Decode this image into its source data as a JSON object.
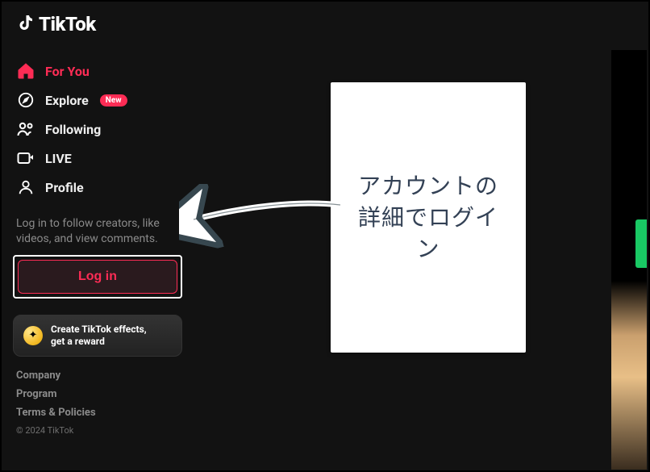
{
  "brand": {
    "name": "TikTok"
  },
  "sidebar": {
    "items": [
      {
        "label": "For You",
        "icon": "home",
        "active": true
      },
      {
        "label": "Explore",
        "icon": "compass",
        "badge": "New"
      },
      {
        "label": "Following",
        "icon": "following"
      },
      {
        "label": "LIVE",
        "icon": "live"
      },
      {
        "label": "Profile",
        "icon": "profile"
      }
    ],
    "login_hint": "Log in to follow creators, like videos, and view comments.",
    "login_button": "Log in",
    "effects": {
      "line1": "Create TikTok effects,",
      "line2": "get a reward"
    }
  },
  "footer": {
    "links": [
      "Company",
      "Program",
      "Terms & Policies"
    ],
    "copyright": "© 2024 TikTok"
  },
  "annotation": {
    "text": "アカウントの詳細でログイン"
  },
  "colors": {
    "accent": "#fe2c55",
    "bg": "#121212"
  }
}
